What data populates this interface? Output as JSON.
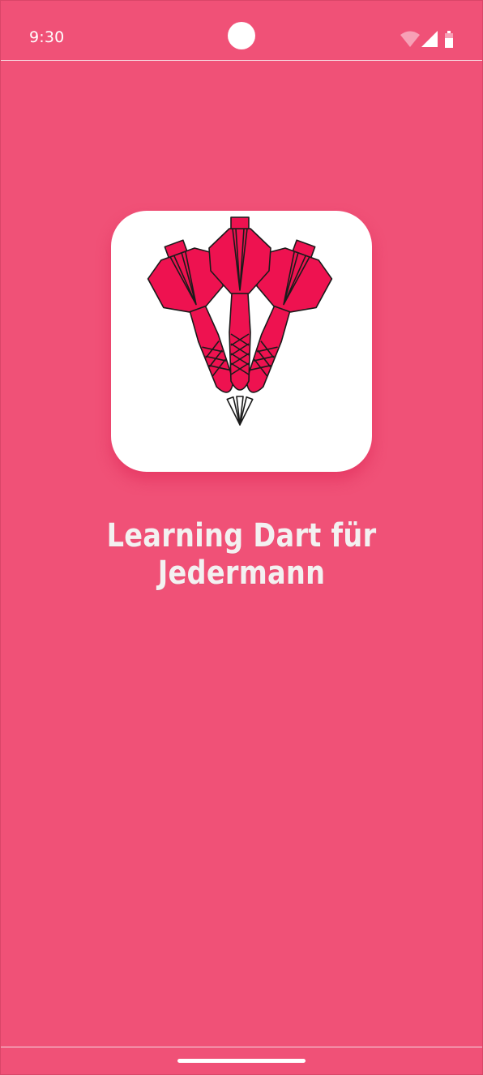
{
  "status_bar": {
    "time": "9:30",
    "icons": [
      "wifi-icon",
      "signal-icon",
      "battery-icon"
    ]
  },
  "splash": {
    "logo": "darts-logo-icon",
    "title": "Learning Dart für Jedermann"
  },
  "colors": {
    "background": "#f05177",
    "card": "#ffffff",
    "dart": "#ee1250",
    "title_text": "#f3f1f1"
  }
}
